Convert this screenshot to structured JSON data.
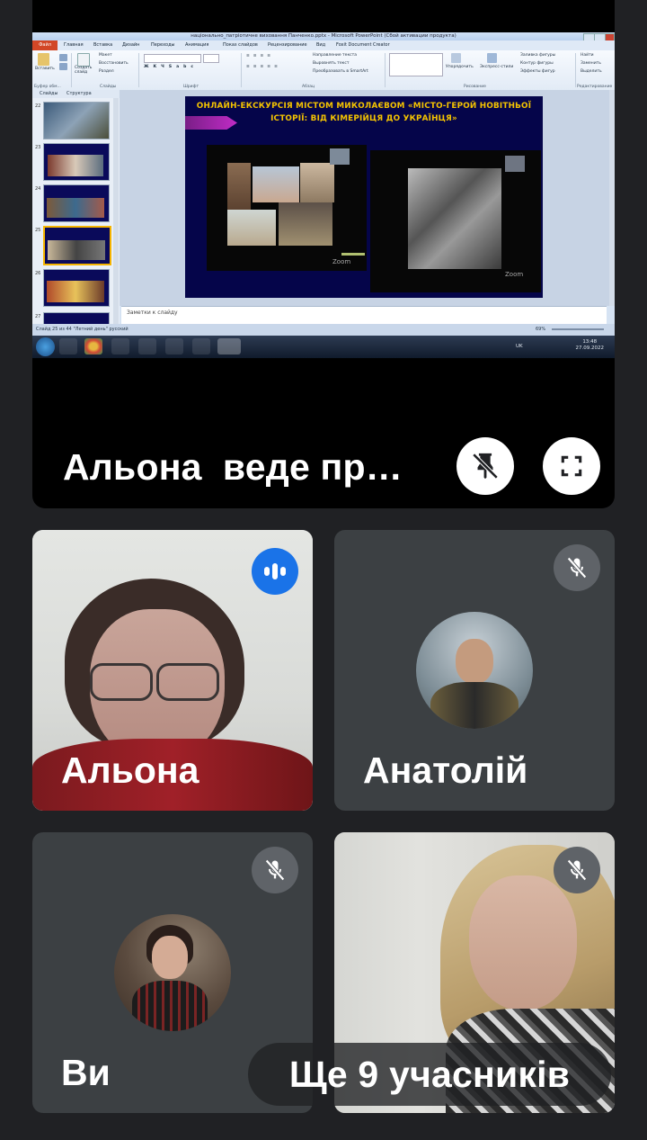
{
  "presentation": {
    "window_title": "національно_патріотичне виховання Панченко.pptx - Microsoft PowerPoint (Сбой активации продукта)",
    "ribbon_tabs": [
      "Файл",
      "Главная",
      "Вставка",
      "Дизайн",
      "Переходы",
      "Анимация",
      "Показ слайдов",
      "Рецензирование",
      "Вид",
      "Foxit Document Creator"
    ],
    "ribbon_groups": [
      "Буфер обм...",
      "Слайды",
      "Шрифт",
      "Абзац",
      "Рисование",
      "Редактирование"
    ],
    "ribbon_buttons": {
      "paste": "Вставить",
      "create_slide": "Создать слайд",
      "layout": "Макет",
      "restore": "Восстановить",
      "section": "Раздел",
      "text_direction": "Направление текста",
      "align_text": "Выровнять текст",
      "smartart": "Преобразовать в SmartArt",
      "arrange": "Упорядочить",
      "quick_styles": "Экспресс-стили",
      "shape_fill": "Заливка фигуры",
      "shape_outline": "Контур фигуры",
      "shape_effects": "Эффекты фигур",
      "find": "Найти",
      "replace": "Заменить",
      "select": "Выделить"
    },
    "panel_tabs": [
      "Слайды",
      "Структура"
    ],
    "thumb_numbers": [
      "22",
      "23",
      "24",
      "25",
      "26",
      "27"
    ],
    "slide_title": "ОНЛАЙН-ЕКСКУРСІЯ МІСТОМ МИКОЛАЄВОМ «МІСТО-ГЕРОЙ НОВІТНЬОЇ ІСТОРІЇ: ВІД КІМЕРІЙЦЯ ДО УКРАЇНЦЯ»",
    "video_watermark": "Zoom",
    "notes_placeholder": "Заметки к слайду",
    "status_text": "Слайд 25 из 44   \"Летний день\"   русский",
    "zoom_level": "69%",
    "clock_time": "13:48",
    "clock_date": "27.09.2022",
    "language": "UK"
  },
  "presenter_label": "Альона  веде пр…",
  "participants": [
    {
      "name": "Альона",
      "state": "speaking"
    },
    {
      "name": "Анатолій",
      "state": "muted"
    },
    {
      "name": "Ви",
      "state": "muted"
    },
    {
      "name": "",
      "state": "muted"
    }
  ],
  "more_participants": "Ще 9 учасників",
  "colors": {
    "background": "#202124",
    "tile": "#3c4043",
    "speaking_badge": "#1a73e8",
    "muted_badge": "#5f6368",
    "slide_title": "#f5c400",
    "slide_bg": "#05054a"
  },
  "icons": {
    "unpin": "unpin-icon",
    "fullscreen": "fullscreen-icon",
    "speaking": "audio-level-icon",
    "muted": "mic-off-icon"
  }
}
